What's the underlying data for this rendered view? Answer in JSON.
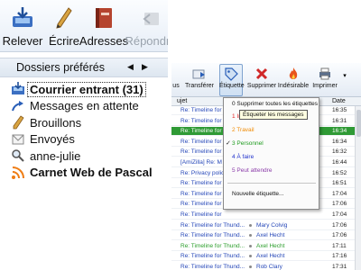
{
  "toolbar": {
    "buttons": [
      {
        "label": "Relever",
        "icon": "inbox-download-icon"
      },
      {
        "label": "Écrire",
        "icon": "pen-icon"
      },
      {
        "label": "Adresses",
        "icon": "address-book-icon"
      },
      {
        "label": "Répondre",
        "icon": "reply-icon"
      }
    ]
  },
  "folders": {
    "title": "Dossiers préférés",
    "items": [
      {
        "label": "Courrier entrant (31)",
        "icon": "inbox-icon",
        "bold": true,
        "selected": true
      },
      {
        "label": "Messages en attente",
        "icon": "outbox-arrow-icon"
      },
      {
        "label": "Brouillons",
        "icon": "drafts-icon"
      },
      {
        "label": "Envoyés",
        "icon": "sent-icon"
      },
      {
        "label": "anne-julie",
        "icon": "search-folder-icon"
      },
      {
        "label": "Carnet Web de Pascal",
        "icon": "rss-feed-icon",
        "bold": true
      }
    ]
  },
  "mail": {
    "toolbar": [
      {
        "label": "us",
        "icon": "forward-icon"
      },
      {
        "label": "Transférer",
        "icon": "forward-icon"
      },
      {
        "label": "Étiquette",
        "icon": "tag-icon"
      },
      {
        "label": "Supprimer",
        "icon": "delete-x-icon"
      },
      {
        "label": "Indésirable",
        "icon": "junk-flame-icon"
      },
      {
        "label": "Imprimer",
        "icon": "print-icon"
      }
    ],
    "columns": {
      "subject": "ujet",
      "date": "Date"
    },
    "rows": [
      {
        "subject": "Re: Timeline for",
        "author": "",
        "date": "16:35",
        "style": "normal"
      },
      {
        "subject": "Re: Timeline for",
        "author": "",
        "date": "16:31",
        "style": "normal"
      },
      {
        "subject": "Re: Timeline for",
        "author": "",
        "date": "16:34",
        "style": "hl"
      },
      {
        "subject": "Re: Timeline for",
        "author": "",
        "date": "16:34",
        "style": "normal"
      },
      {
        "subject": "Re: Timeline for",
        "author": "",
        "date": "16:32",
        "style": "normal"
      },
      {
        "subject": "[AmiZilla] Re: M",
        "author": "",
        "date": "16:44",
        "style": "normal"
      },
      {
        "subject": "Re: Privacy polic",
        "author": "",
        "date": "16:52",
        "style": "normal"
      },
      {
        "subject": "Re: Timeline for",
        "author": "",
        "date": "16:51",
        "style": "normal"
      },
      {
        "subject": "Re: Timeline for",
        "author": "",
        "date": "17:04",
        "style": "normal"
      },
      {
        "subject": "Re: Timeline for",
        "author": "",
        "date": "17:06",
        "style": "normal"
      },
      {
        "subject": "Re: Timeline for",
        "author": "",
        "date": "17:04",
        "style": "normal"
      },
      {
        "subject": "Re: Timeline for Thund...",
        "author": "Mary Colvig",
        "date": "17:06",
        "style": "normal"
      },
      {
        "subject": "Re: Timeline for Thund...",
        "author": "Axel Hecht",
        "date": "17:06",
        "style": "normal"
      },
      {
        "subject": "Re: Timeline for Thund...",
        "author": "Axel Hecht",
        "date": "17:11",
        "style": "green"
      },
      {
        "subject": "Re: Timeline for Thund...",
        "author": "Axel Hecht",
        "date": "17:16",
        "style": "normal"
      },
      {
        "subject": "Re: Timeline for Thund...",
        "author": "Rob Clary",
        "date": "17:31",
        "style": "normal"
      }
    ],
    "menu": {
      "items": [
        {
          "label": "0 Supprimer toutes les étiquettes",
          "color": "#111111"
        },
        {
          "label": "1 Important",
          "color": "#e02020"
        },
        {
          "label": "2 Travail",
          "color": "#f08a00"
        },
        {
          "label": "3 Personnel",
          "color": "#1c9a1c",
          "checked": true
        },
        {
          "label": "4 À faire",
          "color": "#2233cc"
        },
        {
          "label": "5 Peut attendre",
          "color": "#8a3aa8"
        },
        {
          "label": "Nouvelle étiquette...",
          "color": "#111111"
        }
      ],
      "tooltip": "Étiqueter les messages"
    }
  }
}
